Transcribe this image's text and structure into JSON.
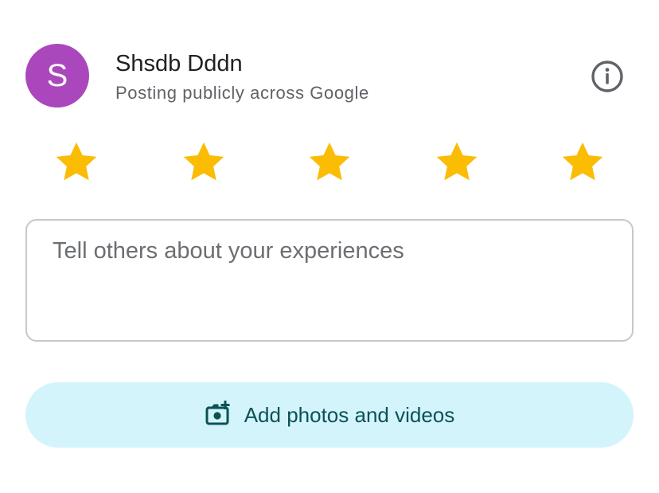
{
  "author": {
    "avatar_initial": "S",
    "avatar_color": "#ab47bc",
    "name": "Shsdb Dddn",
    "posting_note": "Posting publicly across Google"
  },
  "info_button": {
    "icon": "info-icon"
  },
  "rating": {
    "selected": 5,
    "max": 5,
    "star_color": "#fbbc04",
    "icon": "star-icon"
  },
  "review": {
    "value": "",
    "placeholder": "Tell others about your experiences"
  },
  "add_media": {
    "label": "Add photos and videos",
    "icon": "add-photo-camera-icon",
    "background_color": "#d3f4fb",
    "text_color": "#0b5257"
  }
}
